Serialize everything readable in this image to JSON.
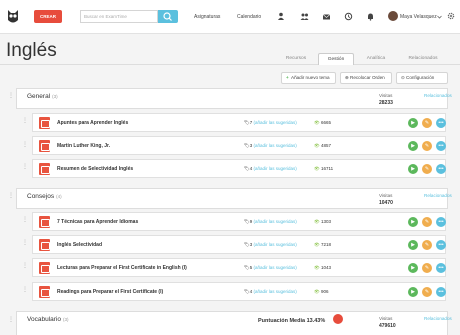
{
  "topbar": {
    "create_label": "CREAR",
    "search_placeholder": "Buscar en ExamTime",
    "nav": [
      "Asignaturas",
      "Calendario"
    ],
    "icons": [
      "person-add-icon",
      "group-icon",
      "mail-icon",
      "history-icon",
      "notifications-icon"
    ],
    "user_name": "Maya Velasquez"
  },
  "page": {
    "title": "Inglés",
    "tabs": [
      "Recursos",
      "Gestión",
      "Analítica",
      "Relacionados"
    ],
    "active_tab": "Gestión",
    "actions": [
      "Añadir nuevo tema",
      "Recolocar Orden",
      "Configuración"
    ]
  },
  "sections": [
    {
      "title": "General",
      "count": "(3)",
      "visits_label": "Visitas",
      "visits": "28233",
      "related": "Relacionados",
      "items": [
        {
          "title": "Apuntes para Aprender Inglés",
          "tags_count": "7",
          "tags_link": "(añadir las sugeridas)",
          "views": "6665"
        },
        {
          "title": "Martin Luther King, Jr.",
          "tags_count": "3",
          "tags_link": "(añadir las sugeridas)",
          "views": "4857"
        },
        {
          "title": "Resumen de Selectividad Inglés",
          "tags_count": "4",
          "tags_link": "(añadir las sugeridas)",
          "views": "16711"
        }
      ]
    },
    {
      "title": "Consejos",
      "count": "(4)",
      "visits_label": "Visitas",
      "visits": "10470",
      "related": "Relacionados",
      "items": [
        {
          "title": "7 Técnicas para Aprender Idiomas",
          "tags_count": "9",
          "tags_link": "(añadir las sugeridas)",
          "views": "1303"
        },
        {
          "title": "Inglés Selectividad",
          "tags_count": "3",
          "tags_link": "(añadir las sugeridas)",
          "views": "7218"
        },
        {
          "title": "Lecturas para Preparar el First Certificate in English (I)",
          "tags_count": "5",
          "tags_link": "(añadir las sugeridas)",
          "views": "1043"
        },
        {
          "title": "Readings para Preparar el First Certificate (I)",
          "tags_count": "4",
          "tags_link": "(añadir las sugeridas)",
          "views": "906"
        }
      ]
    },
    {
      "title": "Vocabulario",
      "count": "(3)",
      "visits_label": "Visitas",
      "visits": "479610",
      "related": "Relacionados",
      "score_label": "Puntuación Media 13.43%",
      "score_value": 13.43,
      "items": []
    }
  ],
  "colors": {
    "create": "#e74c3c",
    "search_button": "#5bc0de",
    "play": "#5cb85c",
    "edit": "#f0ad4e",
    "more": "#5bc0de",
    "link": "#5bc0de"
  }
}
